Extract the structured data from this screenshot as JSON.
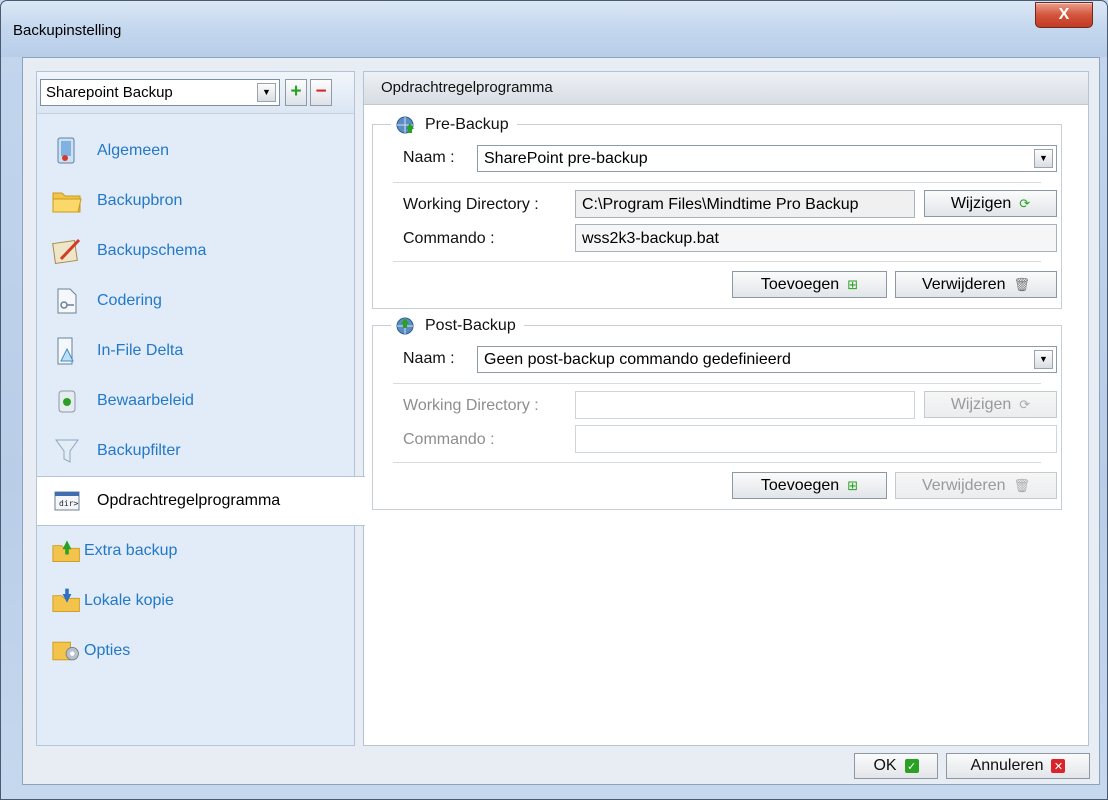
{
  "window": {
    "title": "Backupinstelling",
    "close_label": "X"
  },
  "sidebar": {
    "profile_selected": "Sharepoint Backup",
    "add_label": "+",
    "remove_label": "−",
    "items": [
      {
        "label": "Algemeen",
        "icon": "general-icon"
      },
      {
        "label": "Backupbron",
        "icon": "folder-icon"
      },
      {
        "label": "Backupschema",
        "icon": "schedule-icon"
      },
      {
        "label": "Codering",
        "icon": "encryption-icon"
      },
      {
        "label": "In-File Delta",
        "icon": "delta-icon"
      },
      {
        "label": "Bewaarbeleid",
        "icon": "recycle-bin-icon"
      },
      {
        "label": "Backupfilter",
        "icon": "filter-icon"
      },
      {
        "label": "Opdrachtregelprogramma",
        "icon": "command-line-icon",
        "active": true
      },
      {
        "label": "Extra backup",
        "icon": "extra-backup-icon"
      },
      {
        "label": "Lokale kopie",
        "icon": "local-copy-icon"
      },
      {
        "label": "Opties",
        "icon": "options-icon"
      }
    ]
  },
  "main": {
    "header": "Opdrachtregelprogramma",
    "pre": {
      "legend": "Pre-Backup",
      "name_label": "Naam :",
      "name_value": "SharePoint pre-backup",
      "workdir_label": "Working Directory :",
      "workdir_value": "C:\\Program Files\\Mindtime Pro Backup",
      "change_label": "Wijzigen",
      "command_label": "Commando :",
      "command_value": "wss2k3-backup.bat",
      "add_label": "Toevoegen",
      "remove_label": "Verwijderen"
    },
    "post": {
      "legend": "Post-Backup",
      "name_label": "Naam :",
      "name_value": "Geen post-backup commando gedefinieerd",
      "workdir_label": "Working Directory :",
      "workdir_value": "",
      "change_label": "Wijzigen",
      "command_label": "Commando :",
      "command_value": "",
      "add_label": "Toevoegen",
      "remove_label": "Verwijderen"
    }
  },
  "footer": {
    "ok_label": "OK",
    "cancel_label": "Annuleren"
  },
  "colors": {
    "link_blue": "#2378c8",
    "ok_green": "#2aa024",
    "cancel_red": "#d8242a"
  }
}
